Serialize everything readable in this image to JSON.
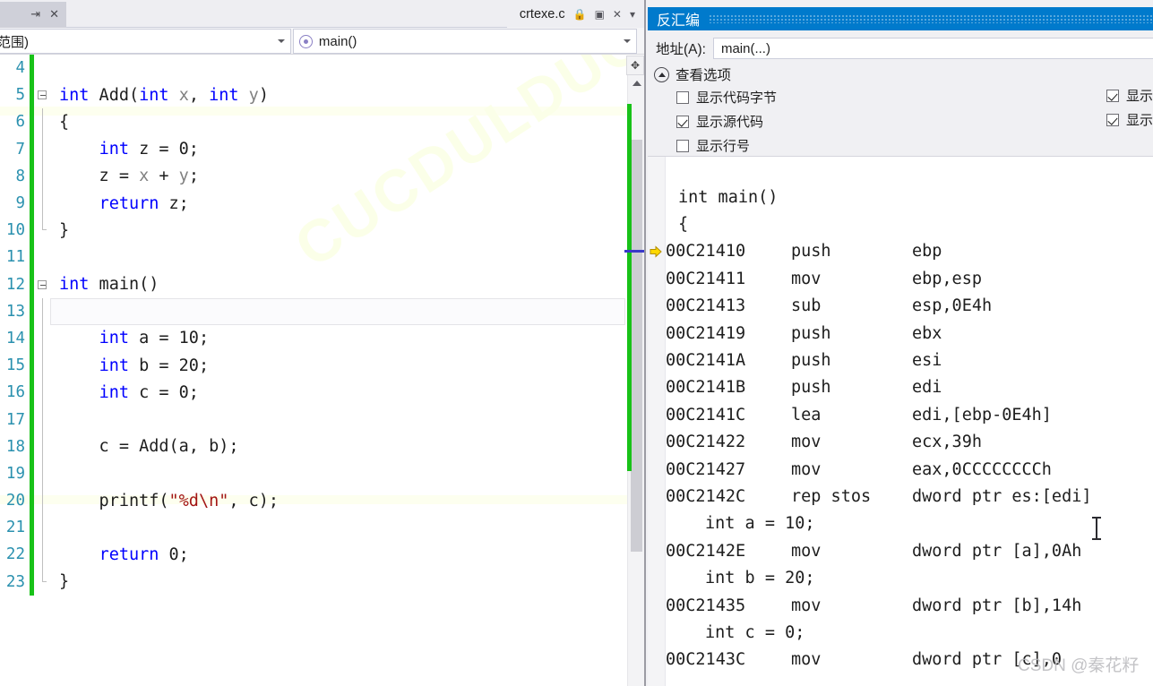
{
  "editor": {
    "tab_left": {
      "pin_icon": "pin-icon",
      "close_icon": "close-icon"
    },
    "tab": {
      "title": "crtexe.c",
      "lock_icon": "lock-icon",
      "window_icon": "window-icon",
      "close_icon": "close-icon",
      "menu_icon": "chevron-down-icon"
    },
    "navbar": {
      "scope_value": "范围)",
      "member_value": "main()"
    },
    "watermark": "CUCDULDUC",
    "lines": [
      {
        "num": "4",
        "text": "",
        "fold": "none"
      },
      {
        "num": "5",
        "text": "int Add(int x, int y)",
        "fold": "box"
      },
      {
        "num": "6",
        "text": "{",
        "fold": "line"
      },
      {
        "num": "7",
        "text": "    int z = 0;",
        "fold": "line"
      },
      {
        "num": "8",
        "text": "    z = x + y;",
        "fold": "line"
      },
      {
        "num": "9",
        "text": "    return z;",
        "fold": "line"
      },
      {
        "num": "10",
        "text": "}",
        "fold": "end"
      },
      {
        "num": "11",
        "text": "",
        "fold": "none"
      },
      {
        "num": "12",
        "text": "int main()",
        "fold": "box"
      },
      {
        "num": "13",
        "text": "{",
        "fold": "line"
      },
      {
        "num": "14",
        "text": "    int a = 10;",
        "fold": "line"
      },
      {
        "num": "15",
        "text": "    int b = 20;",
        "fold": "line"
      },
      {
        "num": "16",
        "text": "    int c = 0;",
        "fold": "line"
      },
      {
        "num": "17",
        "text": "",
        "fold": "line"
      },
      {
        "num": "18",
        "text": "    c = Add(a, b);",
        "fold": "line"
      },
      {
        "num": "19",
        "text": "",
        "fold": "line"
      },
      {
        "num": "20",
        "text": "    printf(\"%d\\n\", c);",
        "fold": "line"
      },
      {
        "num": "21",
        "text": "",
        "fold": "line"
      },
      {
        "num": "22",
        "text": "    return 0;",
        "fold": "line"
      },
      {
        "num": "23",
        "text": "}",
        "fold": "end"
      }
    ],
    "scroll": {
      "split_icon": "split-handle-icon",
      "up_icon": "scroll-up-icon"
    }
  },
  "disassembly": {
    "title": "反汇编",
    "address": {
      "label": "地址(A):",
      "value": "main(...)"
    },
    "options": {
      "header": "查看选项",
      "left_items": [
        {
          "label": "显示代码字节",
          "checked": false
        },
        {
          "label": "显示源代码",
          "checked": true
        },
        {
          "label": "显示行号",
          "checked": false
        }
      ],
      "right_items": [
        {
          "label": "显示",
          "checked": true
        },
        {
          "label": "显示",
          "checked": true
        }
      ]
    },
    "rows": [
      {
        "kind": "src",
        "text": "int main()"
      },
      {
        "kind": "src",
        "text": "{"
      },
      {
        "kind": "asm",
        "addr": "00C21410",
        "mnem": "push",
        "ops": "ebp",
        "current": true
      },
      {
        "kind": "asm",
        "addr": "00C21411",
        "mnem": "mov",
        "ops": "ebp,esp"
      },
      {
        "kind": "asm",
        "addr": "00C21413",
        "mnem": "sub",
        "ops": "esp,0E4h"
      },
      {
        "kind": "asm",
        "addr": "00C21419",
        "mnem": "push",
        "ops": "ebx"
      },
      {
        "kind": "asm",
        "addr": "00C2141A",
        "mnem": "push",
        "ops": "esi"
      },
      {
        "kind": "asm",
        "addr": "00C2141B",
        "mnem": "push",
        "ops": "edi"
      },
      {
        "kind": "asm",
        "addr": "00C2141C",
        "mnem": "lea",
        "ops": "edi,[ebp-0E4h]"
      },
      {
        "kind": "asm",
        "addr": "00C21422",
        "mnem": "mov",
        "ops": "ecx,39h"
      },
      {
        "kind": "asm",
        "addr": "00C21427",
        "mnem": "mov",
        "ops": "eax,0CCCCCCCCh"
      },
      {
        "kind": "asm",
        "addr": "00C2142C",
        "mnem": "rep stos",
        "ops": "dword ptr es:[edi]"
      },
      {
        "kind": "srci",
        "text": "int a = 10;"
      },
      {
        "kind": "asm",
        "addr": "00C2142E",
        "mnem": "mov",
        "ops": "dword ptr [a],0Ah"
      },
      {
        "kind": "srci",
        "text": "int b = 20;"
      },
      {
        "kind": "asm",
        "addr": "00C21435",
        "mnem": "mov",
        "ops": "dword ptr [b],14h"
      },
      {
        "kind": "srci",
        "text": "int c = 0;"
      },
      {
        "kind": "asm",
        "addr": "00C2143C",
        "mnem": "mov",
        "ops": "dword ptr [c],0"
      }
    ],
    "exec_arrow_icon": "execution-pointer-icon",
    "cursor_icon": "text-cursor-icon"
  },
  "watermark_csdn": "CSDN @秦花籽",
  "colors": {
    "accent": "#007acc",
    "changebar": "#18c218",
    "keyword": "#0000ff",
    "string": "#a31515",
    "linenumber": "#2b91af",
    "marker": "#3a39c9"
  }
}
